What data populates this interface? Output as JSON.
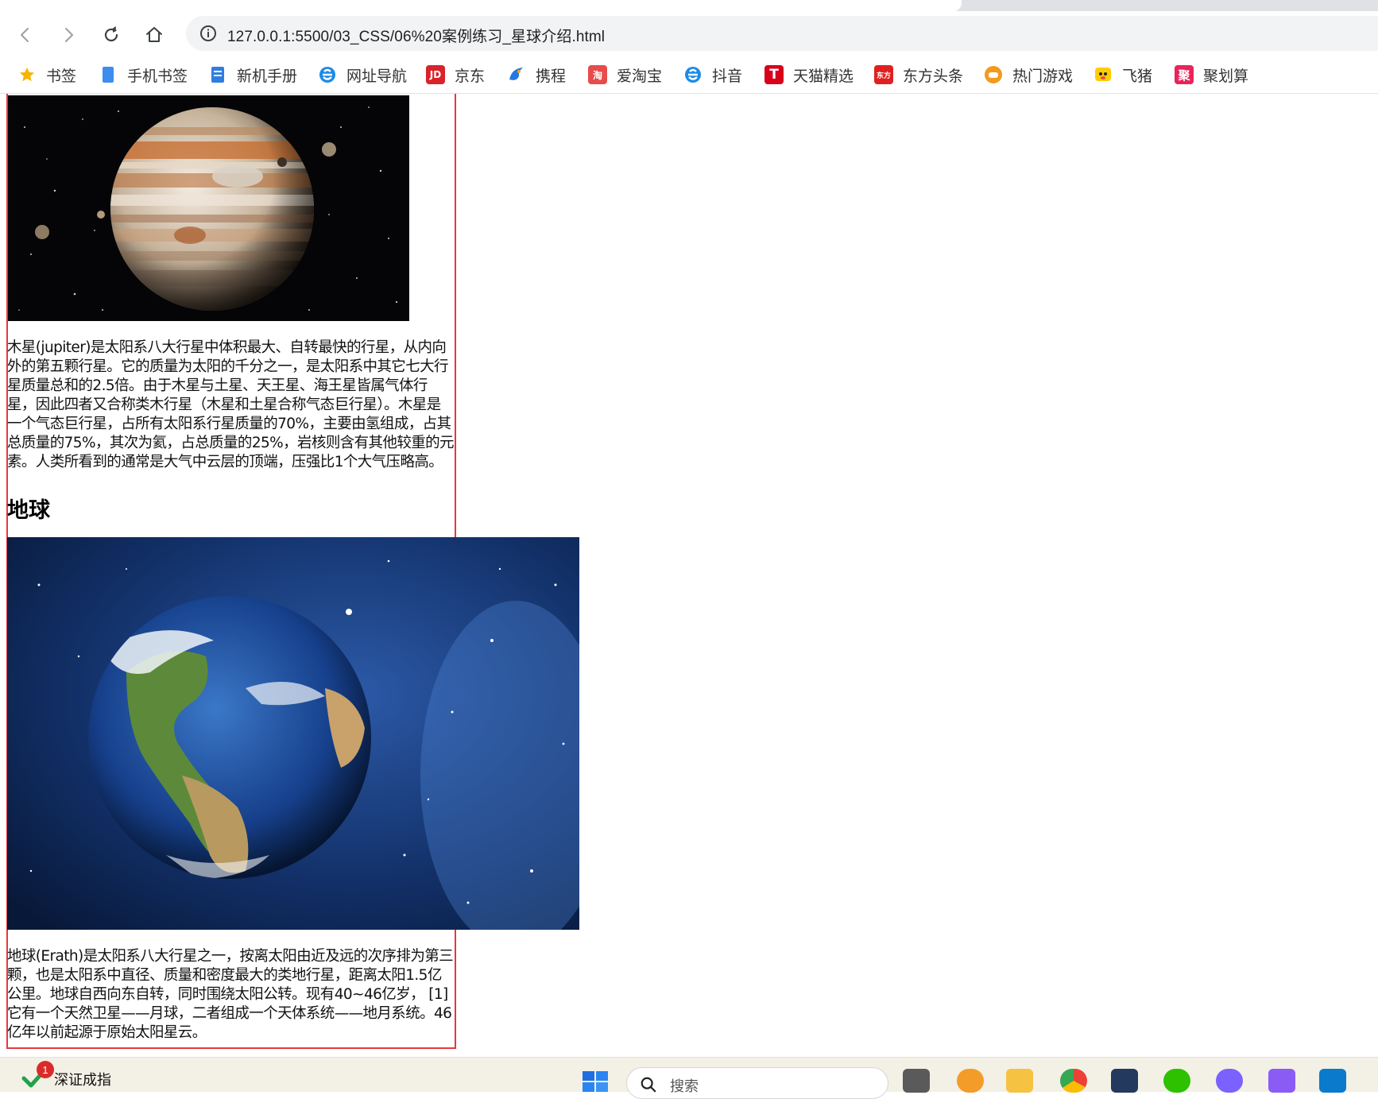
{
  "browser": {
    "url": "127.0.0.1:5500/03_CSS/06%20案例练习_星球介绍.html",
    "nav": {
      "back": "back-arrow-icon",
      "forward": "forward-arrow-icon",
      "reload": "reload-icon",
      "home": "home-icon",
      "info": "info-icon"
    }
  },
  "bookmarks": [
    {
      "label": "书签",
      "icon": "star-icon",
      "color": "#f7b500"
    },
    {
      "label": "手机书签",
      "icon": "phone-bookmark-icon",
      "color": "#3d8cf0"
    },
    {
      "label": "新机手册",
      "icon": "manual-icon",
      "color": "#2f7de1"
    },
    {
      "label": "网址导航",
      "icon": "ie-nav-icon",
      "color": "#1a8be8"
    },
    {
      "label": "京东",
      "icon": "jd-icon",
      "glyph": "JD",
      "color": "#d8232a"
    },
    {
      "label": "携程",
      "icon": "ctrip-icon",
      "color": "#2577e3"
    },
    {
      "label": "爱淘宝",
      "icon": "taobao-icon",
      "glyph": "淘",
      "color": "#e84b4b"
    },
    {
      "label": "抖音",
      "icon": "douyin-nav-icon",
      "color": "#1a8be8"
    },
    {
      "label": "天猫精选",
      "icon": "tmall-icon",
      "glyph": "T",
      "color": "#d9001b"
    },
    {
      "label": "东方头条",
      "icon": "dongfang-icon",
      "glyph": "东方",
      "color": "#e02020"
    },
    {
      "label": "热门游戏",
      "icon": "game-icon",
      "color": "#f29a1f"
    },
    {
      "label": "飞猪",
      "icon": "fliggy-icon",
      "color": "#ffcc00"
    },
    {
      "label": "聚划算",
      "icon": "juhuasuan-icon",
      "glyph": "聚",
      "color": "#e8245a"
    }
  ],
  "page": {
    "jupiter_text": "木星(jupiter)是太阳系八大行星中体积最大、自转最快的行星，从内向外的第五颗行星。它的质量为太阳的千分之一，是太阳系中其它七大行星质量总和的2.5倍。由于木星与土星、天王星、海王星皆属气体行星，因此四者又合称类木行星（木星和土星合称气态巨行星）。木星是一个气态巨行星，占所有太阳系行星质量的70%，主要由氢组成，占其总质量的75%，其次为氦，占总质量的25%，岩核则含有其他较重的元素。人类所看到的通常是大气中云层的顶端，压强比1个大气压略高。",
    "earth_heading": "地球",
    "earth_text": "地球(Erath)是太阳系八大行星之一，按离太阳由近及远的次序排为第三颗，也是太阳系中直径、质量和密度最大的类地行星，距离太阳1.5亿公里。地球自西向东自转，同时围绕太阳公转。现有40~46亿岁， [1] 它有一个天然卫星——月球，二者组成一个天体系统——地月系统。46亿年以前起源于原始太阳星云。",
    "border_color": "#e8373d"
  },
  "taskbar": {
    "stock_name": "深证成指",
    "badge_count": "1",
    "search_placeholder": "搜索"
  }
}
